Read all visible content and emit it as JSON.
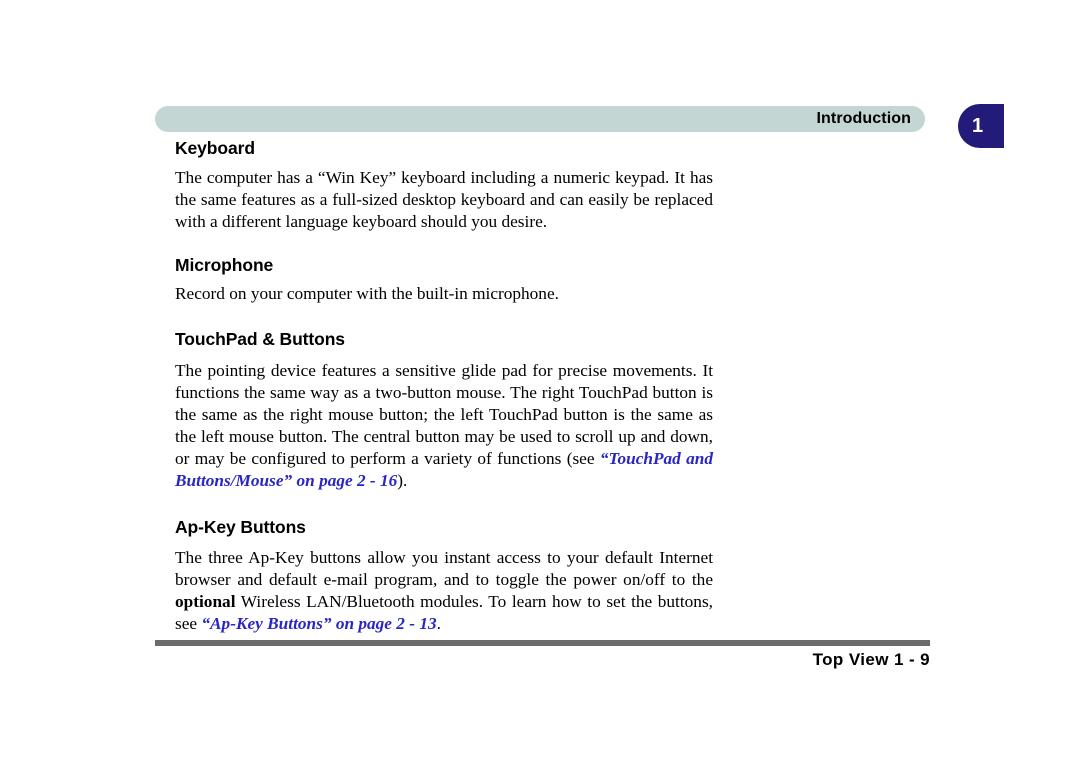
{
  "header": {
    "title": "Introduction",
    "chapter_number": "1",
    "bar_color": "#c3d6d3",
    "tab_color": "#221b7a"
  },
  "footer": {
    "text": "Top View  1  -  9",
    "rule_color": "#6b6b6b"
  },
  "colors": {
    "cross_reference": "#2a26c4",
    "text": "#000000",
    "page_background": "#ffffff"
  },
  "sections": [
    {
      "id": "keyboard",
      "heading": "Keyboard",
      "paragraph": {
        "full_text": "The computer has a “Win Key” keyboard including a numeric keypad. It has the same features as a full-sized desktop keyboard and can easily be replaced with a different language keyboard should you desire.",
        "runs": [
          {
            "style": "normal",
            "text": "The computer has a “Win Key” keyboard including a numeric keypad. It has the same features as a full-sized desktop keyboard and can easily be replaced with a different language keyboard should you desire."
          }
        ]
      }
    },
    {
      "id": "microphone",
      "heading": "Microphone",
      "paragraph": {
        "full_text": "Record on your computer with the built-in microphone.",
        "runs": [
          {
            "style": "normal",
            "text": "Record on your computer with the built-in microphone."
          }
        ]
      }
    },
    {
      "id": "touchpad",
      "heading": "TouchPad & Buttons",
      "paragraph": {
        "full_text": "The pointing device features a sensitive glide pad for precise movements. It functions the same way as a two-button mouse. The right TouchPad button is the same as the right mouse button; the left TouchPad button is the same as the left mouse button. The central button may be used to scroll up and down, or may be configured to perform a variety of functions (see “TouchPad and Buttons/Mouse” on page 2 - 16).",
        "runs": [
          {
            "style": "normal",
            "text": "The pointing device features a sensitive glide pad for precise movements. It functions the same way as a two-button mouse. The right TouchPad button is the same as the right mouse button; the left TouchPad button is the same as the left mouse button. The central button may be used to scroll up and down, or may be configured to perform a variety of functions (see "
          },
          {
            "style": "xref",
            "text": "“TouchPad and Buttons/Mouse” on page 2 - 16"
          },
          {
            "style": "normal",
            "text": ")."
          }
        ]
      }
    },
    {
      "id": "apkey",
      "heading": "Ap-Key Buttons",
      "paragraph": {
        "full_text": "The three Ap-Key buttons allow you instant access to your default Internet browser and default e-mail program, and to toggle the power on/off to the optional Wireless LAN/Bluetooth modules. To learn how to set the buttons, see “Ap-Key Buttons” on page 2 - 13.",
        "runs": [
          {
            "style": "normal",
            "text": "The three Ap-Key buttons allow you instant access to your default Internet browser and default e-mail program, and to toggle the power on/off to the "
          },
          {
            "style": "bold",
            "text": "op­tional"
          },
          {
            "style": "normal",
            "text": " Wireless LAN/Bluetooth modules. To learn how to set the buttons, see "
          },
          {
            "style": "xref",
            "text": "“Ap-Key Buttons” on page 2 - 13"
          },
          {
            "style": "normal",
            "text": "."
          }
        ]
      }
    }
  ]
}
